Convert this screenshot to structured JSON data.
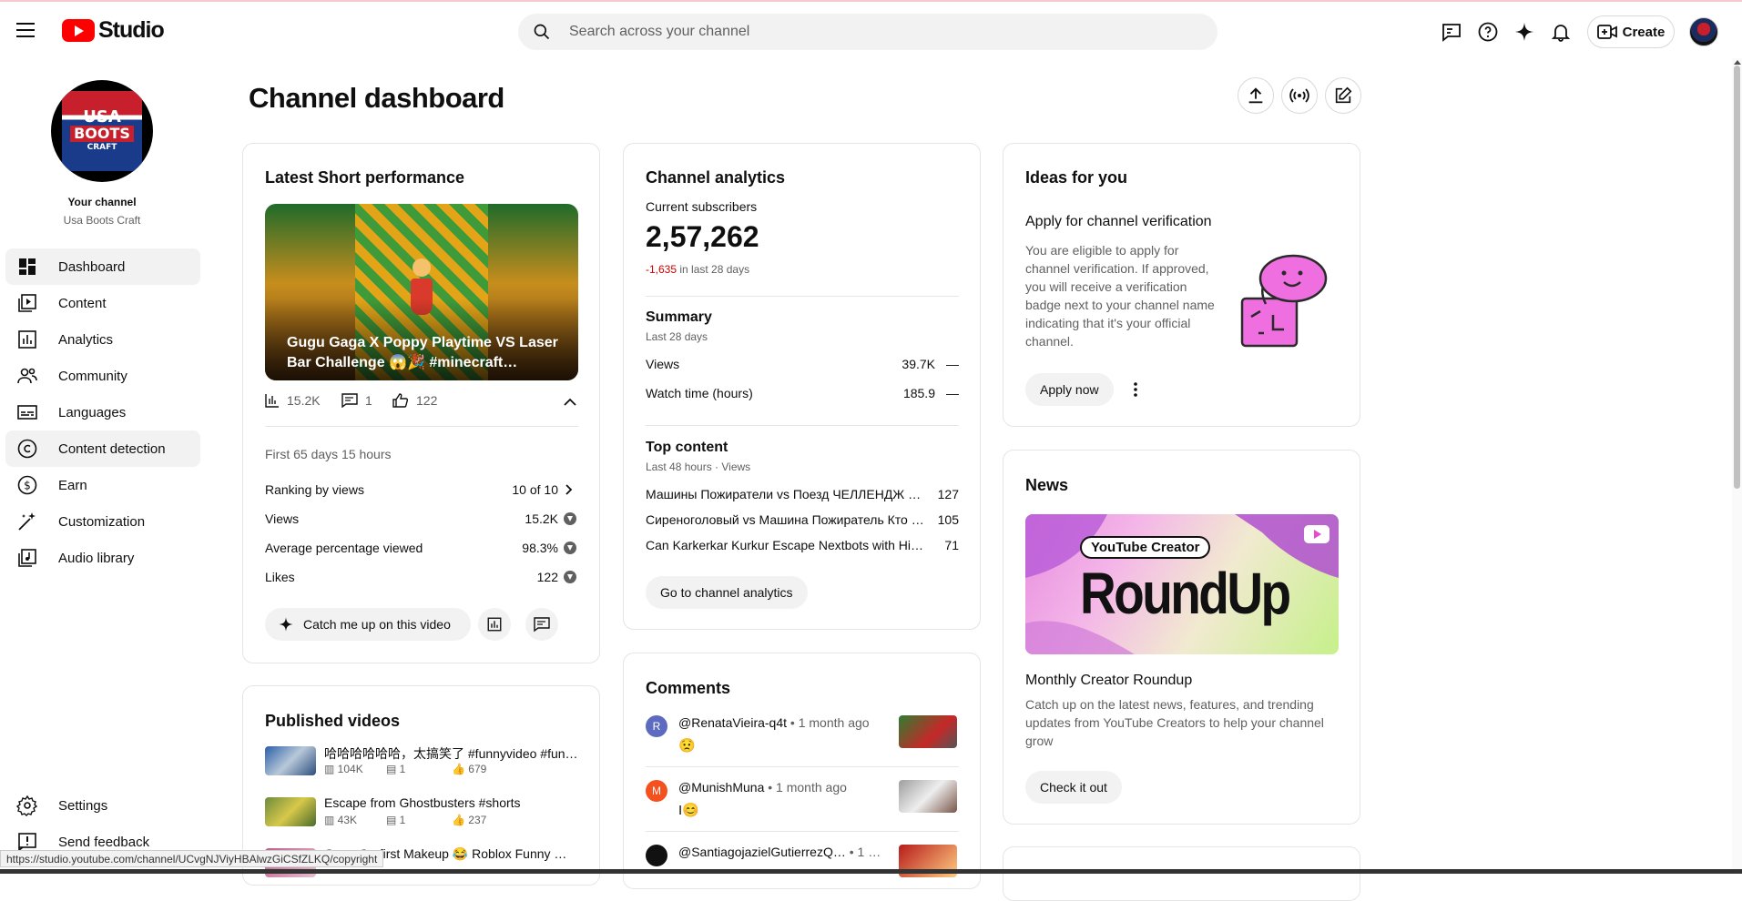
{
  "app": {
    "logo_text": "Studio"
  },
  "header": {
    "search_placeholder": "Search across your channel",
    "create_label": "Create"
  },
  "sidebar": {
    "your_channel": "Your channel",
    "channel_name": "Usa Boots Craft",
    "avatar_text": {
      "line1": "USA",
      "line2": "BOOTS",
      "line3": "CRAFT"
    },
    "items": [
      {
        "label": "Dashboard",
        "icon": "dashboard-icon"
      },
      {
        "label": "Content",
        "icon": "content-icon"
      },
      {
        "label": "Analytics",
        "icon": "analytics-icon"
      },
      {
        "label": "Community",
        "icon": "community-icon"
      },
      {
        "label": "Languages",
        "icon": "subtitles-icon"
      },
      {
        "label": "Content detection",
        "icon": "copyright-icon"
      },
      {
        "label": "Earn",
        "icon": "dollar-icon"
      },
      {
        "label": "Customization",
        "icon": "magic-wand-icon"
      },
      {
        "label": "Audio library",
        "icon": "audio-library-icon"
      }
    ],
    "settings": "Settings",
    "feedback": "Send feedback"
  },
  "status_url": "https://studio.youtube.com/channel/UCvgNJViyHBAlwzGiCSfZLKQ/copyright",
  "main": {
    "title": "Channel dashboard",
    "latest_short": {
      "title": "Latest Short performance",
      "video_title": "Gugu Gaga X Poppy Playtime VS Laser Bar Challenge 😱🎉 #minecraft…",
      "views": "15.2K",
      "comments": "1",
      "likes": "122",
      "period": "First 65 days 15 hours",
      "rows": [
        {
          "label": "Ranking by views",
          "value": "10 of 10"
        },
        {
          "label": "Views",
          "value": "15.2K"
        },
        {
          "label": "Average percentage viewed",
          "value": "98.3%"
        },
        {
          "label": "Likes",
          "value": "122"
        }
      ],
      "catch_up_label": "Catch me up on this video"
    },
    "published": {
      "title": "Published videos",
      "videos": [
        {
          "title": "哈哈哈哈哈哈，太搞笑了 #funnyvideo #fun…",
          "views": "104K",
          "comments": "1",
          "likes": "679"
        },
        {
          "title": "Escape from Ghostbusters #shorts",
          "views": "43K",
          "comments": "1",
          "likes": "237"
        },
        {
          "title": "Gugu Ga first Makeup 😂 Roblox Funny …",
          "views": "",
          "comments": "",
          "likes": ""
        }
      ]
    },
    "analytics": {
      "title": "Channel analytics",
      "subs_label": "Current subscribers",
      "subs_value": "2,57,262",
      "subs_change": "-1,635",
      "subs_change_suffix": "in last 28 days",
      "summary_title": "Summary",
      "summary_period": "Last 28 days",
      "summary_rows": [
        {
          "label": "Views",
          "value": "39.7K",
          "trend": "—"
        },
        {
          "label": "Watch time (hours)",
          "value": "185.9",
          "trend": "—"
        }
      ],
      "top_title": "Top content",
      "top_period": "Last 48 hours · Views",
      "top_rows": [
        {
          "label": "Машины Пожиратели vs Поезд ЧЕЛЛЕНДЖ ч…",
          "value": "127"
        },
        {
          "label": "Сиреноголовый vs Машина Пожиратель Кто …",
          "value": "105"
        },
        {
          "label": "Can Karkerkar Kurkur Escape Nextbots with His …",
          "value": "71"
        }
      ],
      "button": "Go to channel analytics"
    },
    "comments": {
      "title": "Comments",
      "items": [
        {
          "initial": "R",
          "author": "@RenataVieira-q4t",
          "time": "• 1 month ago",
          "text": "😟",
          "color": "#5c6bc0"
        },
        {
          "initial": "M",
          "author": "@MunishMuna",
          "time": "• 1 month ago",
          "text": "I😊",
          "color": "#f4511e"
        },
        {
          "initial": "",
          "author": "@SantiagojazielGutierrezQ…",
          "time": "• 1 …",
          "text": "",
          "color": "#111111"
        }
      ]
    },
    "ideas": {
      "title": "Ideas for you",
      "heading": "Apply for channel verification",
      "body": "You are eligible to apply for channel verification. If approved, you will receive a verification badge next to your channel name indicating that it's your official channel.",
      "button": "Apply now"
    },
    "news": {
      "title": "News",
      "banner_tag": "YouTube Creator",
      "banner_big": "RoundUp",
      "heading": "Monthly Creator Roundup",
      "body": "Catch up on the latest news, features, and trending updates from YouTube Creators to help your channel grow",
      "button": "Check it out"
    }
  }
}
